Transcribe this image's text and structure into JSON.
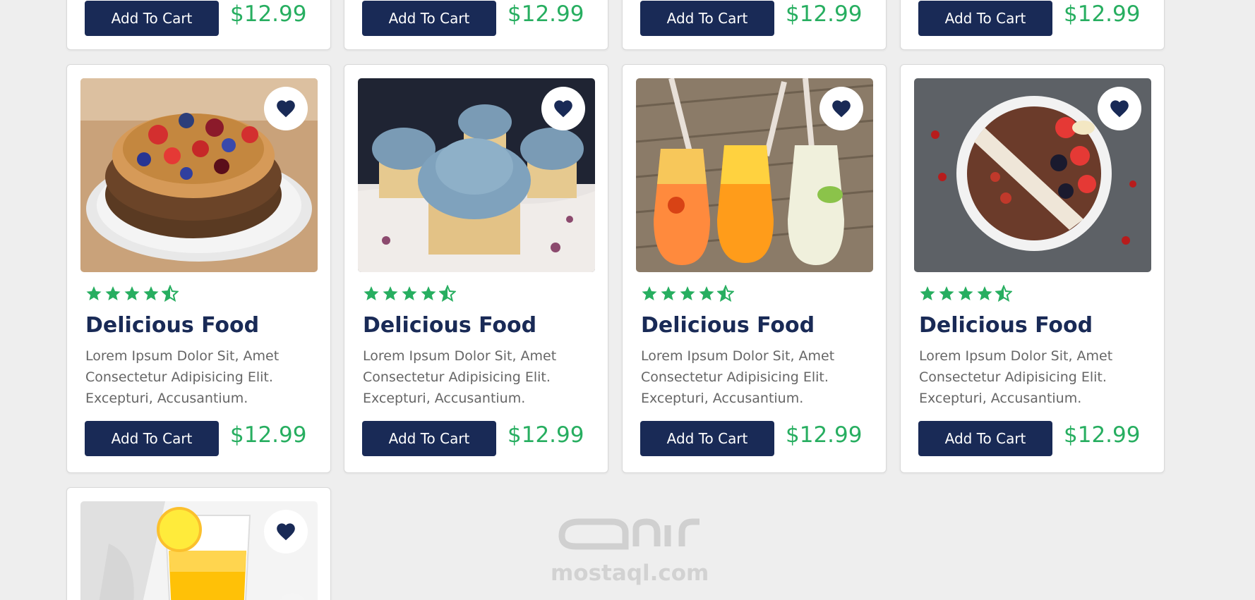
{
  "colors": {
    "accent": "#192a56",
    "green": "#27ae60",
    "text_muted": "#666666",
    "background": "#eeeeee"
  },
  "top_row": [
    {
      "button": "Add To Cart",
      "price": "$12.99"
    },
    {
      "button": "Add To Cart",
      "price": "$12.99"
    },
    {
      "button": "Add To Cart",
      "price": "$12.99"
    },
    {
      "button": "Add To Cart",
      "price": "$12.99"
    }
  ],
  "cards": [
    {
      "image": "berry-caramel-cake",
      "icon": "heart-icon",
      "rating": 4.5,
      "title": "Delicious Food",
      "description": "Lorem Ipsum Dolor Sit, Amet Consectetur Adipisicing Elit. Excepturi, Accusantium.",
      "button": "Add To Cart",
      "price": "$12.99"
    },
    {
      "image": "blue-frosted-cupcakes",
      "icon": "heart-icon",
      "rating": 4.5,
      "title": "Delicious Food",
      "description": "Lorem Ipsum Dolor Sit, Amet Consectetur Adipisicing Elit. Excepturi, Accusantium.",
      "button": "Add To Cart",
      "price": "$12.99"
    },
    {
      "image": "fruit-juice-carafes",
      "icon": "heart-icon",
      "rating": 4.5,
      "title": "Delicious Food",
      "description": "Lorem Ipsum Dolor Sit, Amet Consectetur Adipisicing Elit. Excepturi, Accusantium.",
      "button": "Add To Cart",
      "price": "$12.99"
    },
    {
      "image": "fruit-smoothie-bowl",
      "icon": "heart-icon",
      "rating": 4.5,
      "title": "Delicious Food",
      "description": "Lorem Ipsum Dolor Sit, Amet Consectetur Adipisicing Elit. Excepturi, Accusantium.",
      "button": "Add To Cart",
      "price": "$12.99"
    }
  ],
  "bottom_card": {
    "image": "lemon-juice-glass",
    "icon": "heart-icon"
  },
  "watermark": "mostaql.com"
}
